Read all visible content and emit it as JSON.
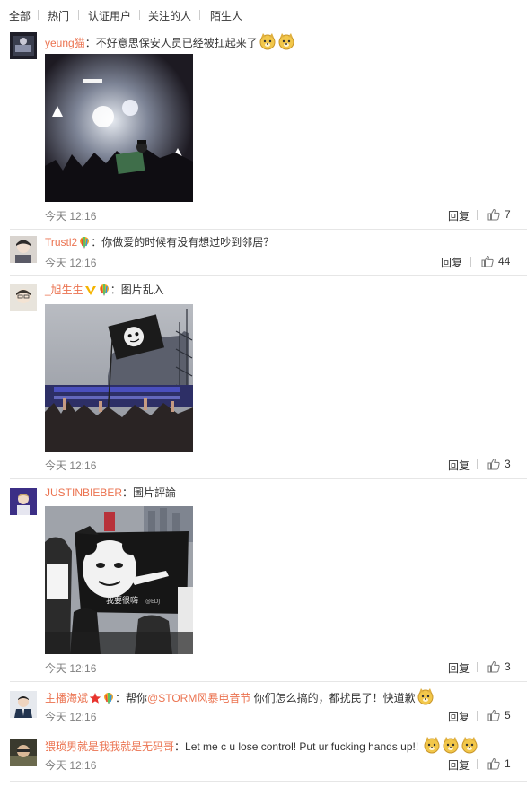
{
  "filters": [
    "全部",
    "热门",
    "认证用户",
    "关注的人",
    "陌生人"
  ],
  "comments": [
    {
      "user": "yeung猫",
      "text": "：不好意思保安人员已经被扛起来了",
      "time": "今天 12:16",
      "reply": "回复",
      "likes": "7",
      "image": "concert-stage-photo",
      "emojis": [
        "doge-emoji",
        "doge-emoji"
      ]
    },
    {
      "user": "Trustl2",
      "text": "：你做爱的时候有没有想过吵到邻居？",
      "time": "今天 12:16",
      "reply": "回复",
      "likes": "44",
      "badges": [
        "rainbow-balloon-icon"
      ]
    },
    {
      "user": "_旭生生",
      "text": "：图片乱入",
      "time": "今天 12:16",
      "reply": "回复",
      "likes": "3",
      "image": "panda-flag-crowd-photo",
      "badges": [
        "vip-v-icon",
        "rainbow-balloon-icon"
      ]
    },
    {
      "user": "JUSTINBIEBER",
      "text": "：圖片評論",
      "time": "今天 12:16",
      "reply": "回复",
      "likes": "3",
      "image": "panda-banner-photo",
      "image_caption": "我要很嗨",
      "image_watermark": "@EDJ"
    },
    {
      "user": "主播海斌",
      "text_before": "：帮你",
      "mention": "@STORM风暴电音节",
      "text_after": " 你们怎么搞的，都扰民了！快道歉",
      "time": "今天 12:16",
      "reply": "回复",
      "likes": "5",
      "badges": [
        "red-star-icon",
        "rainbow-balloon-icon"
      ],
      "emojis": [
        "doge-emoji"
      ]
    },
    {
      "user": "猥琐男就是我我就是无码哥",
      "text": "：Let me c u lose control! Put ur fucking hands up!! ",
      "time": "今天 12:16",
      "reply": "回复",
      "likes": "1",
      "emojis": [
        "doge-emoji",
        "doge-emoji",
        "doge-emoji"
      ]
    }
  ],
  "colors": {
    "username": "#eb7350",
    "time": "#808080",
    "divider": "#e6e6e6"
  }
}
